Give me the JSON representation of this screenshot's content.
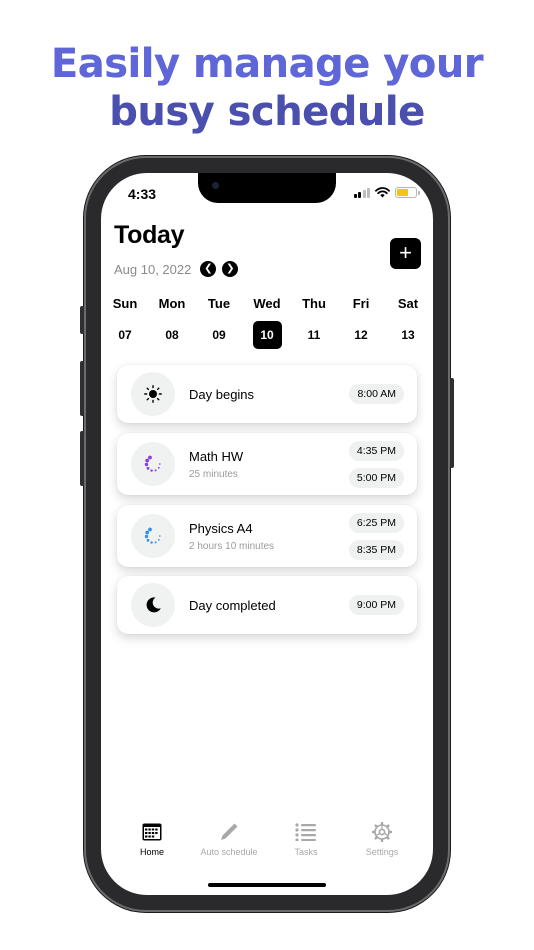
{
  "headline": {
    "line1": "Easily manage your",
    "line2": "busy schedule"
  },
  "status_bar": {
    "time": "4:33",
    "signal_icon": "signal-icon",
    "wifi_icon": "wifi-icon",
    "battery_icon": "battery-icon"
  },
  "header": {
    "title": "Today",
    "date": "Aug 10, 2022",
    "add_label": "+",
    "prev_icon": "chevron-left-icon",
    "next_icon": "chevron-right-icon"
  },
  "week": [
    {
      "name": "Sun",
      "date": "07",
      "selected": false
    },
    {
      "name": "Mon",
      "date": "08",
      "selected": false
    },
    {
      "name": "Tue",
      "date": "09",
      "selected": false
    },
    {
      "name": "Wed",
      "date": "10",
      "selected": true
    },
    {
      "name": "Thu",
      "date": "11",
      "selected": false
    },
    {
      "name": "Fri",
      "date": "12",
      "selected": false
    },
    {
      "name": "Sat",
      "date": "13",
      "selected": false
    }
  ],
  "schedule": [
    {
      "title": "Day begins",
      "subtitle": "",
      "icon": "sun-icon",
      "times": [
        "8:00 AM"
      ]
    },
    {
      "title": "Math HW",
      "subtitle": "25 minutes",
      "icon": "progress-spinner-icon",
      "icon_color": "#8a3fe0",
      "times": [
        "4:35 PM",
        "5:00 PM"
      ]
    },
    {
      "title": "Physics A4",
      "subtitle": "2 hours 10 minutes",
      "icon": "progress-spinner-icon",
      "icon_color": "#3a8fe8",
      "times": [
        "6:25 PM",
        "8:35 PM"
      ]
    },
    {
      "title": "Day completed",
      "subtitle": "",
      "icon": "moon-icon",
      "times": [
        "9:00 PM"
      ]
    }
  ],
  "tabs": [
    {
      "label": "Home",
      "icon": "calendar-icon",
      "active": true
    },
    {
      "label": "Auto schedule",
      "icon": "pencil-icon",
      "active": false
    },
    {
      "label": "Tasks",
      "icon": "list-icon",
      "active": false
    },
    {
      "label": "Settings",
      "icon": "gear-icon",
      "active": false
    }
  ],
  "colors": {
    "headline_start": "#5e66d8",
    "headline_end": "#4b4fae",
    "accent": "#000000",
    "math_icon": "#8a3fe0",
    "physics_icon": "#3a8fe8"
  }
}
